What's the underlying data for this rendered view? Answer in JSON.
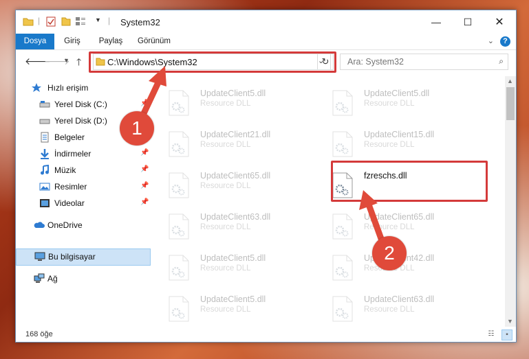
{
  "window": {
    "title": "System32",
    "controls": [
      "minimize",
      "maximize",
      "close"
    ]
  },
  "ribbon": {
    "tabs": [
      "Dosya",
      "Giriş",
      "Paylaş",
      "Görünüm"
    ],
    "active_tab": "Dosya",
    "help": "?"
  },
  "address": {
    "path": "C:\\Windows\\System32"
  },
  "search": {
    "placeholder": "Ara: System32"
  },
  "sidebar": {
    "items": [
      {
        "label": "Hızlı erişim",
        "icon": "star-icon"
      },
      {
        "label": "Yerel Disk (C:)",
        "icon": "drive-icon",
        "pinned": true
      },
      {
        "label": "Yerel Disk (D:)",
        "icon": "drive-icon",
        "pinned": true
      },
      {
        "label": "Belgeler",
        "icon": "documents-icon",
        "pinned": true
      },
      {
        "label": "İndirmeler",
        "icon": "download-icon",
        "pinned": true
      },
      {
        "label": "Müzik",
        "icon": "music-icon",
        "pinned": true
      },
      {
        "label": "Resimler",
        "icon": "pictures-icon",
        "pinned": true
      },
      {
        "label": "Videolar",
        "icon": "video-icon",
        "pinned": true
      },
      {
        "label": "OneDrive",
        "icon": "cloud-icon"
      },
      {
        "label": "Bu bilgisayar",
        "icon": "computer-icon",
        "selected": true
      },
      {
        "label": "Ağ",
        "icon": "network-icon"
      }
    ]
  },
  "files": [
    {
      "name": "UpdateClient5.dll",
      "desc": "Resource DLL",
      "faded": true
    },
    {
      "name": "UpdateClient5.dll",
      "desc": "Resource DLL",
      "faded": true
    },
    {
      "name": "UpdateClient21.dll",
      "desc": "Resource DLL",
      "faded": true
    },
    {
      "name": "UpdateClient15.dll",
      "desc": "Resource DLL",
      "faded": true
    },
    {
      "name": "UpdateClient65.dll",
      "desc": "Resource DLL",
      "faded": true
    },
    {
      "name": "fzreschs.dll",
      "desc": "",
      "faded": false
    },
    {
      "name": "UpdateClient63.dll",
      "desc": "Resource DLL",
      "faded": true
    },
    {
      "name": "UpdateClient65.dll",
      "desc": "Resource DLL",
      "faded": true
    },
    {
      "name": "UpdateClient5.dll",
      "desc": "Resource DLL",
      "faded": true
    },
    {
      "name": "UpdateClient42.dll",
      "desc": "Resource DLL",
      "faded": true
    },
    {
      "name": "UpdateClient5.dll",
      "desc": "Resource DLL",
      "faded": true
    },
    {
      "name": "UpdateClient63.dll",
      "desc": "Resource DLL",
      "faded": true
    }
  ],
  "status": {
    "count": "168 öğe"
  },
  "annotations": {
    "step1": "1",
    "step2": "2",
    "color": "#d43a3a"
  }
}
